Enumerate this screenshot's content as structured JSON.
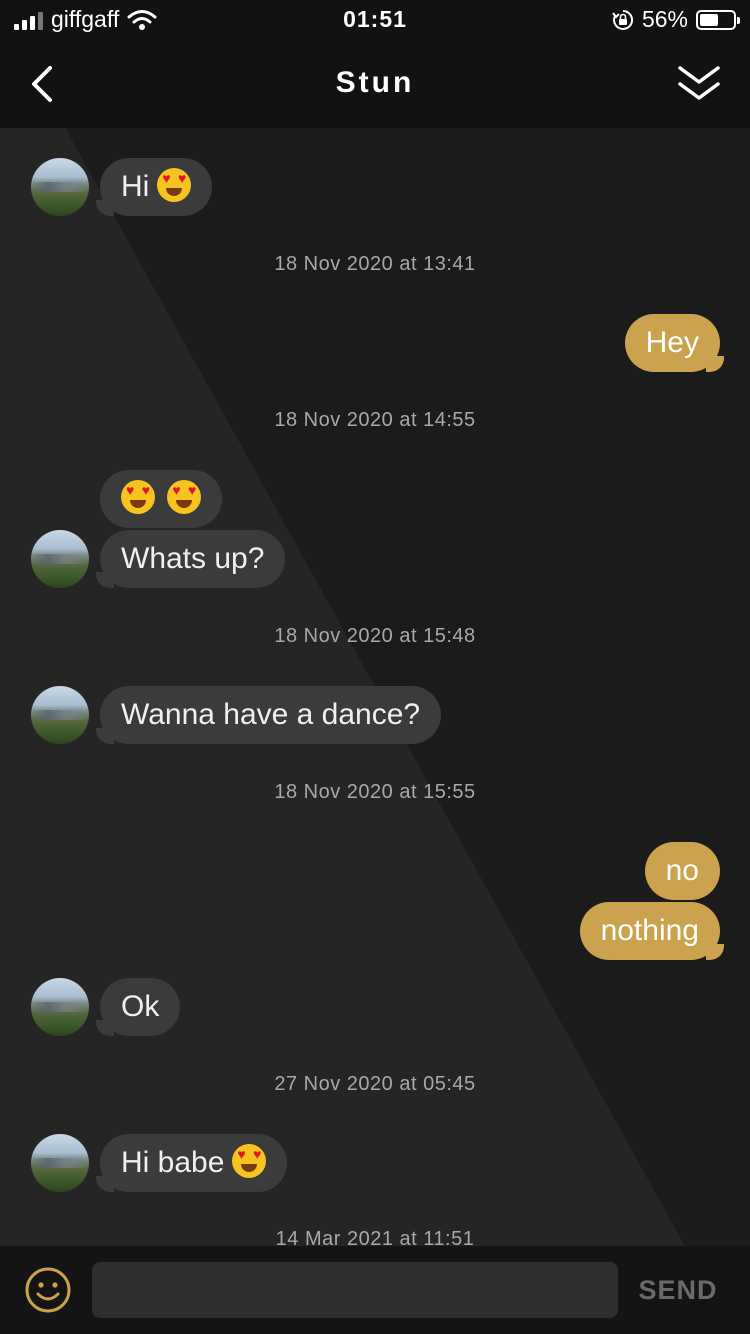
{
  "status_bar": {
    "carrier": "giffgaff",
    "time": "01:51",
    "battery_percent": "56%",
    "battery_level": 0.56,
    "icons": [
      "signal-icon",
      "wifi-icon",
      "orientation-lock-icon",
      "battery-icon"
    ]
  },
  "header": {
    "title": "Stun",
    "icons": [
      "back-chevron-icon",
      "double-chevron-down-icon"
    ]
  },
  "messages": {
    "m1": "Hi",
    "ts1": "18 Nov 2020 at 13:41",
    "m2": "Hey",
    "ts2": "18 Nov 2020 at 14:55",
    "m4": "Whats up?",
    "ts3": "18 Nov 2020 at 15:48",
    "m5": "Wanna have a dance?",
    "ts4": "18 Nov 2020 at 15:55",
    "m6": "no",
    "m7": "nothing",
    "m8": "Ok",
    "ts5": "27 Nov 2020 at 05:45",
    "m9": "Hi babe",
    "ts6": "14 Mar 2021 at 11:51",
    "emoji": "heart-eyes-emoji"
  },
  "composer": {
    "placeholder": "",
    "value": "",
    "send_label": "SEND",
    "icons": [
      "smiley-icon"
    ]
  },
  "colors": {
    "outgoing_bubble": "#cba24d",
    "incoming_bubble": "#3b3b3b",
    "background": "#1e1e1e",
    "bar": "#121212"
  }
}
